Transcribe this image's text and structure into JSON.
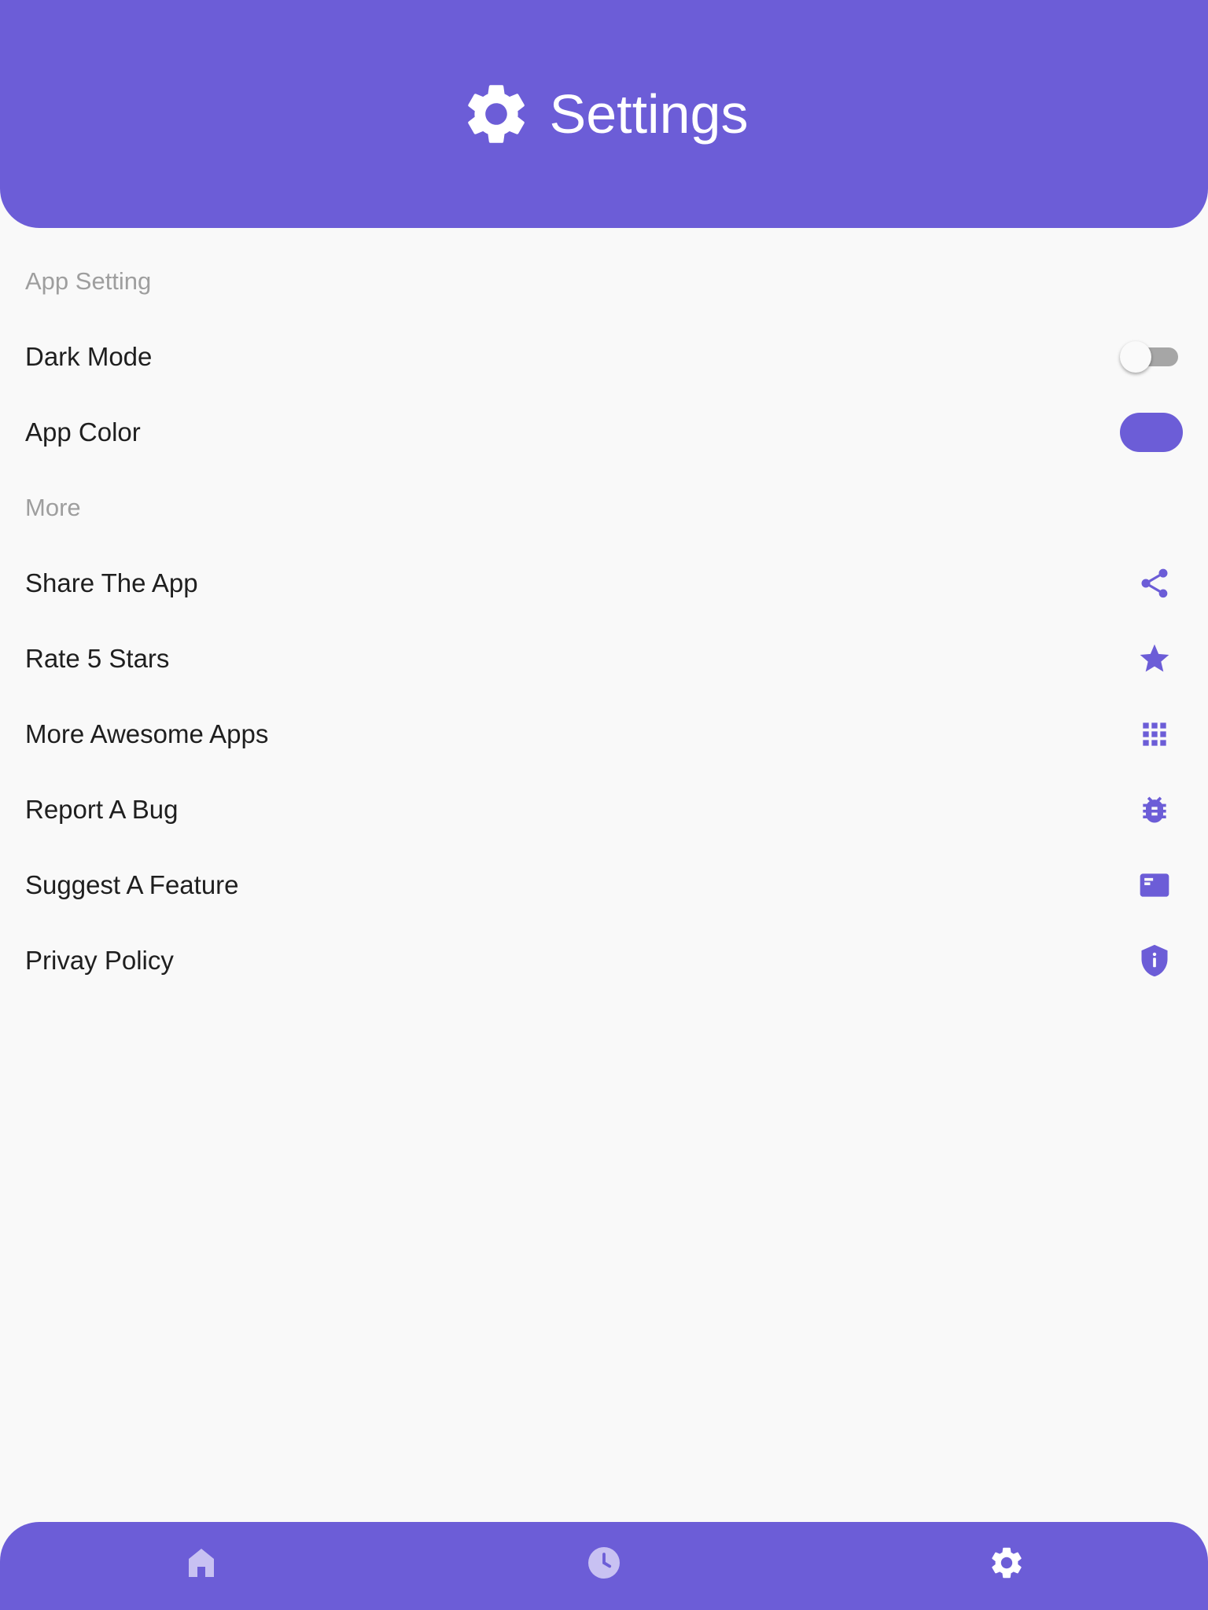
{
  "header": {
    "title": "Settings",
    "icon": "gear-icon"
  },
  "colors": {
    "primary": "#6c5dd7",
    "background": "#f9f9f9",
    "nav_inactive": "#c8c1f2",
    "nav_active": "#ffffff"
  },
  "sections": {
    "app_setting": {
      "label": "App Setting",
      "items": [
        {
          "label": "Dark Mode",
          "control": "toggle",
          "value": "off"
        },
        {
          "label": "App Color",
          "control": "color-swatch",
          "value": "#6c5dd7"
        }
      ]
    },
    "more": {
      "label": "More",
      "items": [
        {
          "label": "Share The App",
          "icon": "share-icon"
        },
        {
          "label": "Rate 5 Stars",
          "icon": "star-icon"
        },
        {
          "label": "More Awesome Apps",
          "icon": "apps-grid-icon"
        },
        {
          "label": "Report A Bug",
          "icon": "bug-icon"
        },
        {
          "label": "Suggest A Feature",
          "icon": "feature-card-icon"
        },
        {
          "label": "Privay Policy",
          "icon": "privacy-shield-icon"
        }
      ]
    }
  },
  "bottom_nav": [
    {
      "icon": "home-icon",
      "active": false
    },
    {
      "icon": "clock-icon",
      "active": false
    },
    {
      "icon": "gear-icon",
      "active": true
    }
  ]
}
